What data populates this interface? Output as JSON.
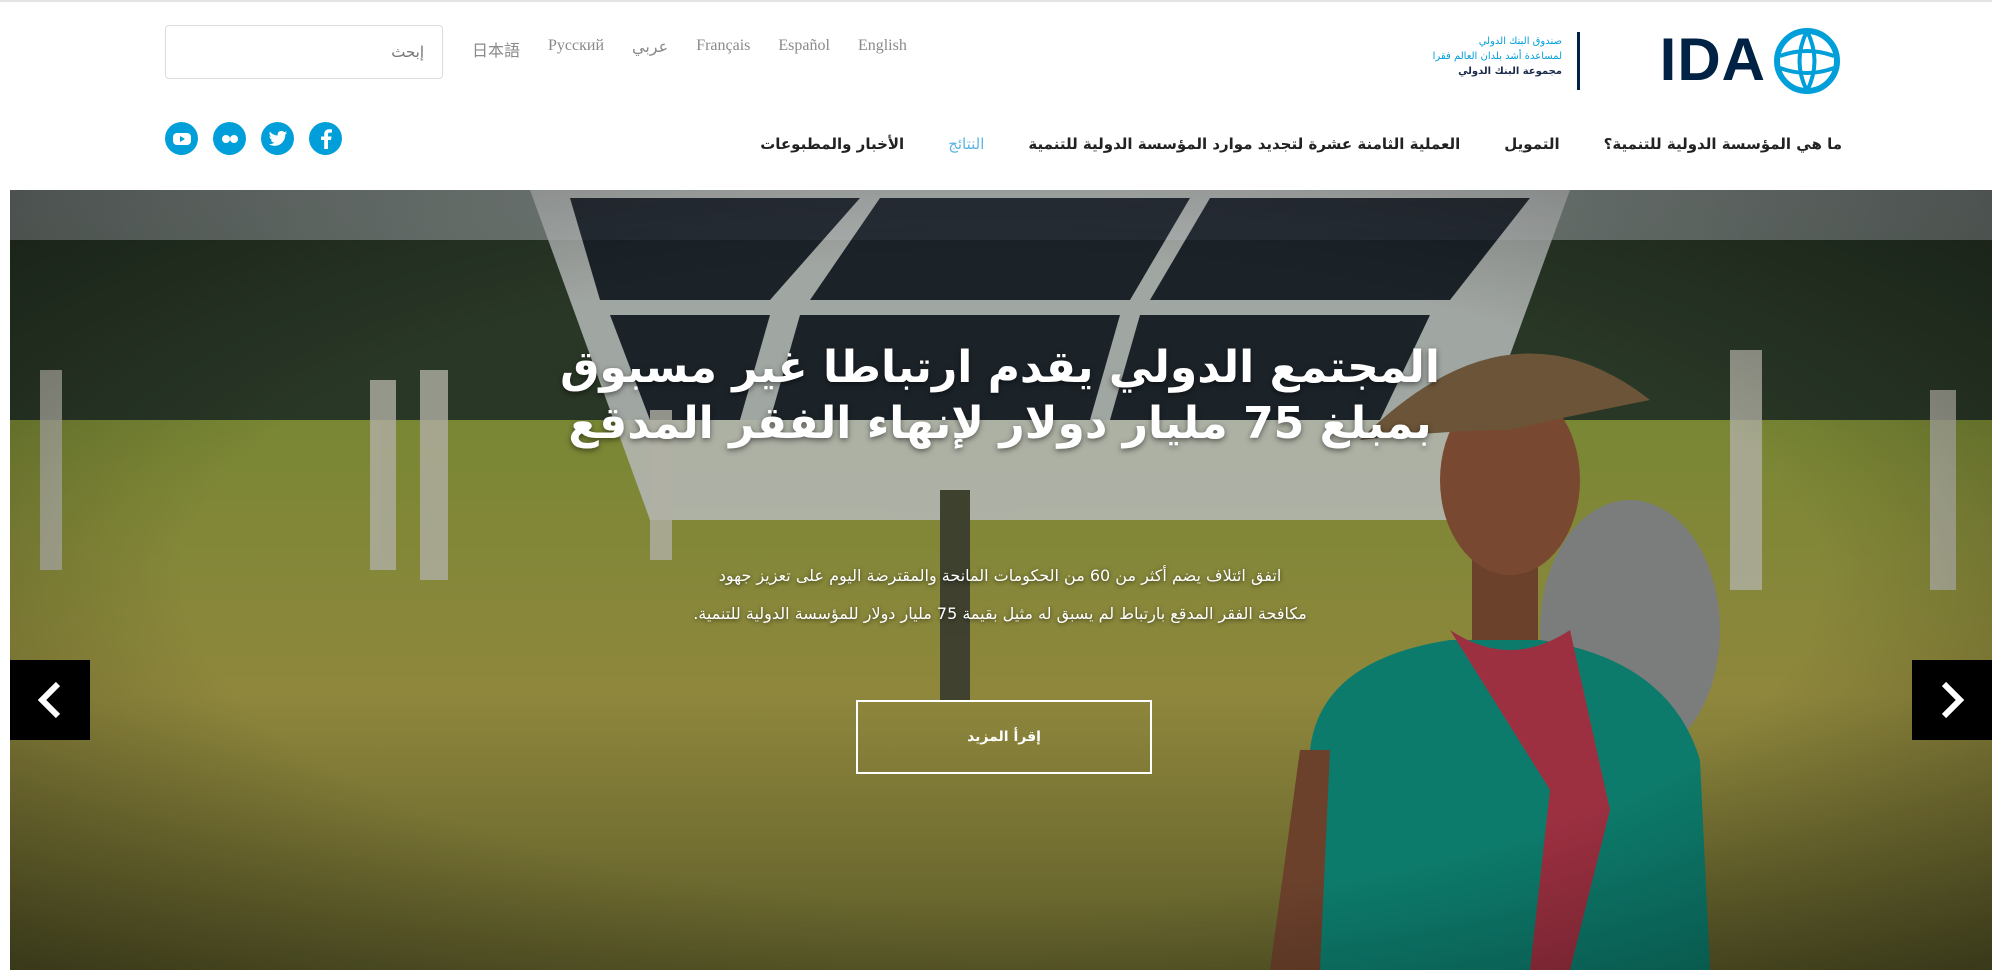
{
  "header": {
    "search": {
      "placeholder": "إبحث"
    },
    "languages": [
      "日本語",
      "Русский",
      "عربي",
      "Français",
      "Español",
      "English"
    ],
    "logo": {
      "text": "IDA",
      "sub_line1": "صندوق البنك الدولي",
      "sub_line2": "لمساعدة أشد بلدان العالم فقرا",
      "sub_line3": "مجموعة البنك الدولي"
    },
    "social_icons": [
      "youtube-icon",
      "flickr-icon",
      "twitter-icon",
      "facebook-icon"
    ],
    "nav": [
      {
        "label": "ما هي المؤسسة الدولية للتنمية؟",
        "active": false
      },
      {
        "label": "التمويل",
        "active": false
      },
      {
        "label": "العملية الثامنة عشرة لتجديد موارد المؤسسة الدولية للتنمية",
        "active": false
      },
      {
        "label": "النتائج",
        "active": true
      },
      {
        "label": "الأخبار والمطبوعات",
        "active": false
      }
    ]
  },
  "hero": {
    "title": "المجتمع الدولي يقدم ارتباطا غير مسبوق بمبلغ 75 مليار دولار لإنهاء الفقر المدقع",
    "description_line1": "اتفق ائتلاف يضم أكثر من 60 من الحكومات المانحة والمقترضة اليوم على تعزيز جهود",
    "description_line2": "مكافحة الفقر المدقع بارتباط لم يسبق له مثيل بقيمة 75 مليار دولار للمؤسسة الدولية للتنمية.",
    "read_more": "إقرأ المزيد"
  },
  "colors": {
    "brand_navy": "#002244",
    "brand_blue": "#009fda",
    "nav_active": "#5ab5e0"
  }
}
